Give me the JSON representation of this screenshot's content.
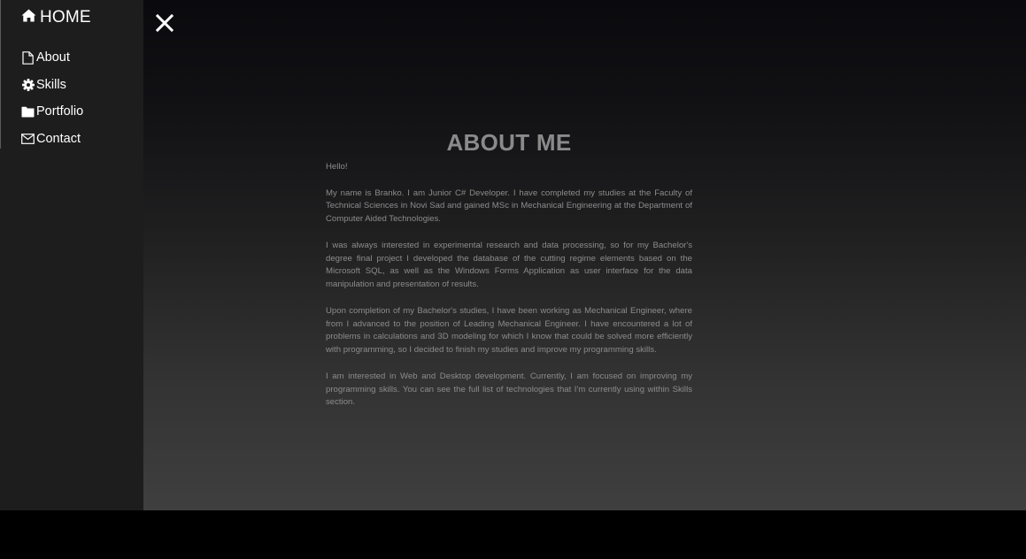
{
  "sidebar": {
    "home_label": "HOME",
    "items": [
      {
        "label": "About",
        "icon": "file-icon"
      },
      {
        "label": "Skills",
        "icon": "gear-icon"
      },
      {
        "label": "Portfolio",
        "icon": "folder-icon"
      },
      {
        "label": "Contact",
        "icon": "envelope-icon"
      }
    ]
  },
  "close_icon": "close-icon",
  "about": {
    "title": "ABOUT ME",
    "paragraphs": [
      "Hello!",
      "My name is Branko. I am Junior C# Developer. I have completed my studies at the Faculty of Technical Sciences in Novi Sad and gained MSc in Mechanical Engineering at the Department of Computer Aided Technologies.",
      "I was always interested in experimental research and data processing, so for my Bachelor's degree final project I developed the database of the cutting regime elements based on the Microsoft SQL, as well as the Windows Forms Application as user interface for the data manipulation and presentation of results.",
      "Upon completion of my Bachelor's studies, I have been working as Mechanical Engineer, where from I advanced to the position of Leading Mechanical Engineer. I have encountered a lot of problems in calculations and 3D modeling for which I know that could be solved more efficiently with programming, so I decided to finish my studies and improve my programming skills.",
      "I am interested in Web and Desktop development. Currently, I am focused on improving my programming skills. You can see the full list of technologies that I'm currently using within Skills section."
    ]
  },
  "colors": {
    "sidebar_bg": "#1d1d1d",
    "text_light": "#ffffff",
    "content_text": "#8c8c8c"
  }
}
